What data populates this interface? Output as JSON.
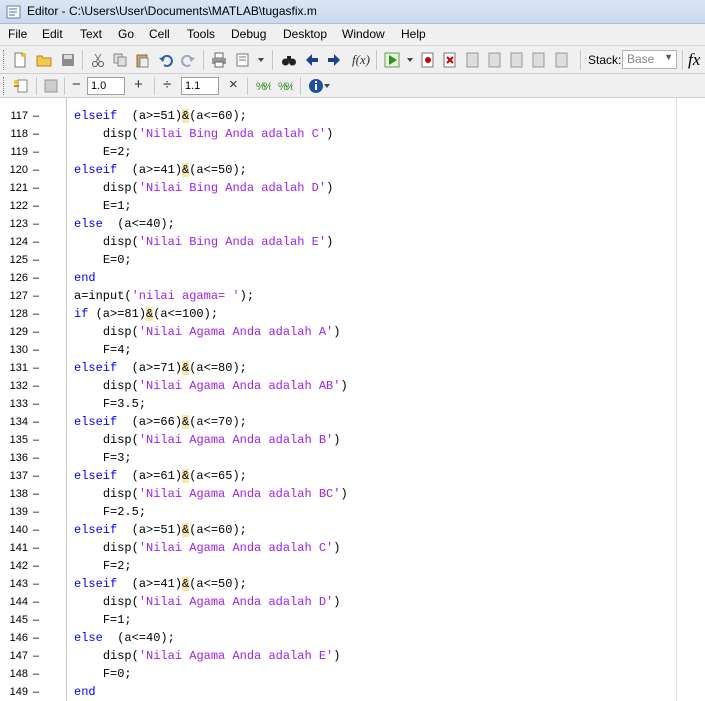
{
  "window": {
    "title": "Editor - C:\\Users\\User\\Documents\\MATLAB\\tugasfix.m"
  },
  "menu": [
    "File",
    "Edit",
    "Text",
    "Go",
    "Cell",
    "Tools",
    "Debug",
    "Desktop",
    "Window",
    "Help"
  ],
  "toolbar": {
    "stack_label": "Stack:",
    "stack_value": "Base",
    "fx_label": "fx",
    "cell_inc_value": "1.0",
    "cell_div_value": "1.1"
  },
  "editor": {
    "lines": [
      {
        "n": "117",
        "dash": "–",
        "indent": "",
        "seg": [
          [
            "kw",
            "elseif"
          ],
          [
            "",
            "  (a>=51)"
          ],
          [
            "amp",
            "&"
          ],
          [
            "",
            "(a<=60);"
          ]
        ]
      },
      {
        "n": "118",
        "dash": "–",
        "indent": "    ",
        "seg": [
          [
            "",
            "disp("
          ],
          [
            "str",
            "'Nilai Bing Anda adalah C'"
          ],
          [
            "",
            ")"
          ]
        ]
      },
      {
        "n": "119",
        "dash": "–",
        "indent": "    ",
        "seg": [
          [
            "",
            "E=2;"
          ]
        ]
      },
      {
        "n": "120",
        "dash": "–",
        "indent": "",
        "seg": [
          [
            "kw",
            "elseif"
          ],
          [
            "",
            "  (a>=41)"
          ],
          [
            "amp",
            "&"
          ],
          [
            "",
            "(a<=50);"
          ]
        ]
      },
      {
        "n": "121",
        "dash": "–",
        "indent": "    ",
        "seg": [
          [
            "",
            "disp("
          ],
          [
            "str",
            "'Nilai Bing Anda adalah D'"
          ],
          [
            "",
            ")"
          ]
        ]
      },
      {
        "n": "122",
        "dash": "–",
        "indent": "    ",
        "seg": [
          [
            "",
            "E=1;"
          ]
        ]
      },
      {
        "n": "123",
        "dash": "–",
        "indent": "",
        "seg": [
          [
            "kw",
            "else"
          ],
          [
            "",
            "  (a<=40);"
          ]
        ]
      },
      {
        "n": "124",
        "dash": "–",
        "indent": "    ",
        "seg": [
          [
            "",
            "disp("
          ],
          [
            "str",
            "'Nilai Bing Anda adalah E'"
          ],
          [
            "",
            ")"
          ]
        ]
      },
      {
        "n": "125",
        "dash": "–",
        "indent": "    ",
        "seg": [
          [
            "",
            "E=0;"
          ]
        ]
      },
      {
        "n": "126",
        "dash": "–",
        "indent": "",
        "seg": [
          [
            "kw",
            "end"
          ]
        ]
      },
      {
        "n": "127",
        "dash": "–",
        "indent": "",
        "seg": [
          [
            "",
            "a=input("
          ],
          [
            "str",
            "'nilai agama= '"
          ],
          [
            "",
            ");"
          ]
        ]
      },
      {
        "n": "128",
        "dash": "–",
        "indent": "",
        "seg": [
          [
            "kw",
            "if"
          ],
          [
            "",
            " (a>=81)"
          ],
          [
            "amp",
            "&"
          ],
          [
            "",
            "(a<=100);"
          ]
        ]
      },
      {
        "n": "129",
        "dash": "–",
        "indent": "    ",
        "seg": [
          [
            "",
            "disp("
          ],
          [
            "str",
            "'Nilai Agama Anda adalah A'"
          ],
          [
            "",
            ")"
          ]
        ]
      },
      {
        "n": "130",
        "dash": "–",
        "indent": "    ",
        "seg": [
          [
            "",
            "F=4;"
          ]
        ]
      },
      {
        "n": "131",
        "dash": "–",
        "indent": "",
        "seg": [
          [
            "kw",
            "elseif"
          ],
          [
            "",
            "  (a>=71)"
          ],
          [
            "amp",
            "&"
          ],
          [
            "",
            "(a<=80);"
          ]
        ]
      },
      {
        "n": "132",
        "dash": "–",
        "indent": "    ",
        "seg": [
          [
            "",
            "disp("
          ],
          [
            "str",
            "'Nilai Agama Anda adalah AB'"
          ],
          [
            "",
            ")"
          ]
        ]
      },
      {
        "n": "133",
        "dash": "–",
        "indent": "    ",
        "seg": [
          [
            "",
            "F=3.5;"
          ]
        ]
      },
      {
        "n": "134",
        "dash": "–",
        "indent": "",
        "seg": [
          [
            "kw",
            "elseif"
          ],
          [
            "",
            "  (a>=66)"
          ],
          [
            "amp",
            "&"
          ],
          [
            "",
            "(a<=70);"
          ]
        ]
      },
      {
        "n": "135",
        "dash": "–",
        "indent": "    ",
        "seg": [
          [
            "",
            "disp("
          ],
          [
            "str",
            "'Nilai Agama Anda adalah B'"
          ],
          [
            "",
            ")"
          ]
        ]
      },
      {
        "n": "136",
        "dash": "–",
        "indent": "    ",
        "seg": [
          [
            "",
            "F=3;"
          ]
        ]
      },
      {
        "n": "137",
        "dash": "–",
        "indent": "",
        "seg": [
          [
            "kw",
            "elseif"
          ],
          [
            "",
            "  (a>=61)"
          ],
          [
            "amp",
            "&"
          ],
          [
            "",
            "(a<=65);"
          ]
        ]
      },
      {
        "n": "138",
        "dash": "–",
        "indent": "    ",
        "seg": [
          [
            "",
            "disp("
          ],
          [
            "str",
            "'Nilai Agama Anda adalah BC'"
          ],
          [
            "",
            ")"
          ]
        ]
      },
      {
        "n": "139",
        "dash": "–",
        "indent": "    ",
        "seg": [
          [
            "",
            "F=2.5;"
          ]
        ]
      },
      {
        "n": "140",
        "dash": "–",
        "indent": "",
        "seg": [
          [
            "kw",
            "elseif"
          ],
          [
            "",
            "  (a>=51)"
          ],
          [
            "amp",
            "&"
          ],
          [
            "",
            "(a<=60);"
          ]
        ]
      },
      {
        "n": "141",
        "dash": "–",
        "indent": "    ",
        "seg": [
          [
            "",
            "disp("
          ],
          [
            "str",
            "'Nilai Agama Anda adalah C'"
          ],
          [
            "",
            ")"
          ]
        ]
      },
      {
        "n": "142",
        "dash": "–",
        "indent": "    ",
        "seg": [
          [
            "",
            "F=2;"
          ]
        ]
      },
      {
        "n": "143",
        "dash": "–",
        "indent": "",
        "seg": [
          [
            "kw",
            "elseif"
          ],
          [
            "",
            "  (a>=41)"
          ],
          [
            "amp",
            "&"
          ],
          [
            "",
            "(a<=50);"
          ]
        ]
      },
      {
        "n": "144",
        "dash": "–",
        "indent": "    ",
        "seg": [
          [
            "",
            "disp("
          ],
          [
            "str",
            "'Nilai Agama Anda adalah D'"
          ],
          [
            "",
            ")"
          ]
        ]
      },
      {
        "n": "145",
        "dash": "–",
        "indent": "    ",
        "seg": [
          [
            "",
            "F=1;"
          ]
        ]
      },
      {
        "n": "146",
        "dash": "–",
        "indent": "",
        "seg": [
          [
            "kw",
            "else"
          ],
          [
            "",
            "  (a<=40);"
          ]
        ]
      },
      {
        "n": "147",
        "dash": "–",
        "indent": "    ",
        "seg": [
          [
            "",
            "disp("
          ],
          [
            "str",
            "'Nilai Agama Anda adalah E'"
          ],
          [
            "",
            ")"
          ]
        ]
      },
      {
        "n": "148",
        "dash": "–",
        "indent": "    ",
        "seg": [
          [
            "",
            "F=0;"
          ]
        ]
      },
      {
        "n": "149",
        "dash": "–",
        "indent": "",
        "seg": [
          [
            "kw",
            "end"
          ]
        ]
      }
    ]
  }
}
